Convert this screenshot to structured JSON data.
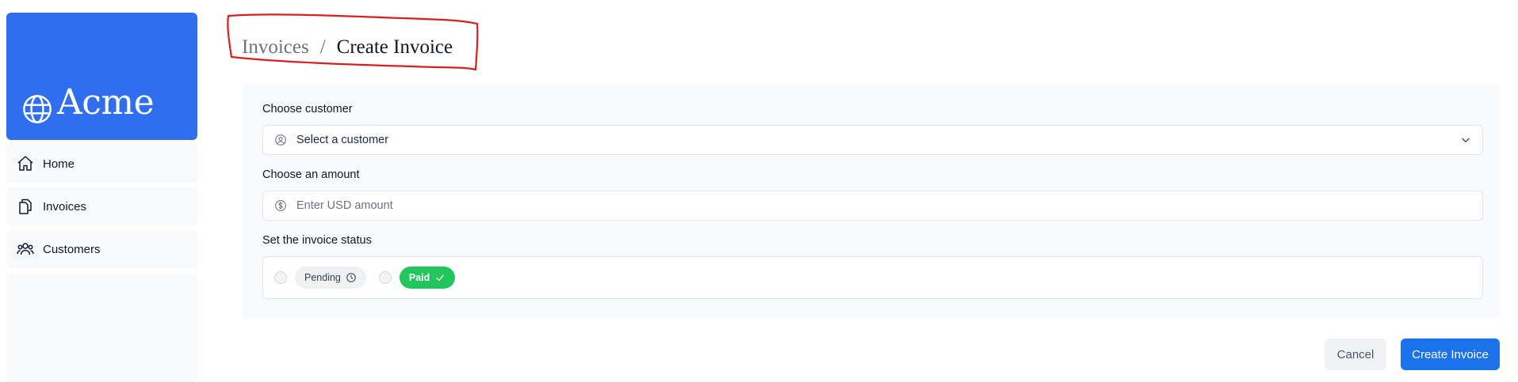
{
  "brand": {
    "name": "Acme",
    "icon": "globe-icon",
    "color": "#2f6fed"
  },
  "sidebar": {
    "items": [
      {
        "label": "Home",
        "icon": "home-icon"
      },
      {
        "label": "Invoices",
        "icon": "document-duplicate-icon"
      },
      {
        "label": "Customers",
        "icon": "user-group-icon"
      }
    ]
  },
  "breadcrumb": {
    "parent": "Invoices",
    "separator": "/",
    "current": "Create Invoice"
  },
  "form": {
    "customer": {
      "label": "Choose customer",
      "value": "Select a customer",
      "icon": "user-circle-icon"
    },
    "amount": {
      "label": "Choose an amount",
      "placeholder": "Enter USD amount",
      "icon": "currency-dollar-icon"
    },
    "status": {
      "label": "Set the invoice status",
      "options": [
        {
          "label": "Pending",
          "icon": "clock-icon"
        },
        {
          "label": "Paid",
          "icon": "check-icon",
          "color": "#22c55e"
        }
      ]
    }
  },
  "actions": {
    "cancel": "Cancel",
    "submit": "Create Invoice",
    "submit_color": "#1a73e8"
  }
}
